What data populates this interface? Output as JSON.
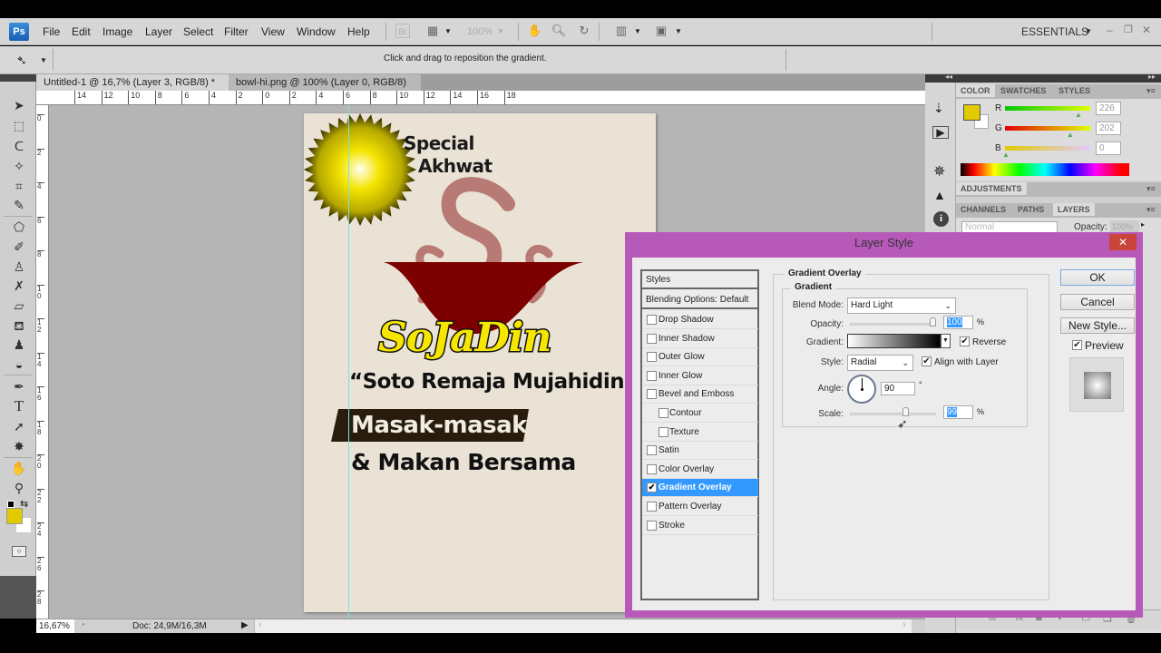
{
  "app": {
    "logo": "Ps"
  },
  "menu": [
    "File",
    "Edit",
    "Image",
    "Layer",
    "Select",
    "Filter",
    "View",
    "Window",
    "Help"
  ],
  "toolbar": {
    "zoom_level": "100%",
    "workspace": "ESSENTIALS",
    "zoom_caret": "▾"
  },
  "options_bar": {
    "hint": "Click and drag to reposition the gradient."
  },
  "doc_tabs": [
    {
      "label": "Untitled-1 @ 16,7% (Layer 3, RGB/8) *",
      "active": true
    },
    {
      "label": "bowl-hi.png @ 100% (Layer 0, RGB/8)",
      "active": false
    }
  ],
  "ruler_top": [
    "14",
    "12",
    "10",
    "8",
    "6",
    "4",
    "2",
    "0",
    "2",
    "4",
    "6",
    "8",
    "10",
    "12",
    "14",
    "16",
    "18"
  ],
  "ruler_left": [
    "0",
    "2",
    "4",
    "6",
    "8",
    "10",
    "12",
    "14",
    "16",
    "18",
    "20",
    "22",
    "24",
    "26",
    "28"
  ],
  "status": {
    "zoom": "16,67%",
    "doc": "Doc: 24,9M/16,3M"
  },
  "canvas": {
    "special": "Special",
    "akhwat": "Akhwat",
    "title": "SoJaDin",
    "subtitle": "“Soto Remaja Mujahidin”",
    "banner": "Masak-masak",
    "line2": "& Makan Bersama"
  },
  "color_panel": {
    "tabs": [
      "COLOR",
      "SWATCHES",
      "STYLES"
    ],
    "r": "226",
    "g": "202",
    "b": "0",
    "r_label": "R",
    "g_label": "G",
    "b_label": "B",
    "foreground": "#e2ca00",
    "background": "#ffffff"
  },
  "adjustments_tab": "ADJUSTMENTS",
  "layers_tabs": [
    "CHANNELS",
    "PATHS",
    "LAYERS"
  ],
  "layers": {
    "blend": "Normal",
    "opacity_label": "Opacity:",
    "opacity": "100%"
  },
  "dialog": {
    "title": "Layer Style",
    "styles_header": "Styles",
    "blending": "Blending Options: Default",
    "effects": [
      {
        "label": "Drop Shadow",
        "checked": false,
        "indent": false
      },
      {
        "label": "Inner Shadow",
        "checked": false,
        "indent": false
      },
      {
        "label": "Outer Glow",
        "checked": false,
        "indent": false
      },
      {
        "label": "Inner Glow",
        "checked": false,
        "indent": false
      },
      {
        "label": "Bevel and Emboss",
        "checked": false,
        "indent": false
      },
      {
        "label": "Contour",
        "checked": false,
        "indent": true
      },
      {
        "label": "Texture",
        "checked": false,
        "indent": true
      },
      {
        "label": "Satin",
        "checked": false,
        "indent": false
      },
      {
        "label": "Color Overlay",
        "checked": false,
        "indent": false
      },
      {
        "label": "Gradient Overlay",
        "checked": true,
        "indent": false,
        "selected": true
      },
      {
        "label": "Pattern Overlay",
        "checked": false,
        "indent": false
      },
      {
        "label": "Stroke",
        "checked": false,
        "indent": false
      }
    ],
    "section": "Gradient Overlay",
    "subsection": "Gradient",
    "blend_mode_label": "Blend Mode:",
    "blend_mode": "Hard Light",
    "opacity_label": "Opacity:",
    "opacity": "100",
    "opacity_pct": 100,
    "gradient_label": "Gradient:",
    "reverse_label": "Reverse",
    "reverse": true,
    "style_label": "Style:",
    "style": "Radial",
    "align_label": "Align with Layer",
    "align": true,
    "angle_label": "Angle:",
    "angle": "90",
    "degree": "°",
    "scale_label": "Scale:",
    "scale": "99",
    "scale_pct": 99,
    "pct": "%",
    "ok": "OK",
    "cancel": "Cancel",
    "new_style": "New Style...",
    "preview_label": "Preview",
    "preview": true,
    "close": "✕"
  },
  "checkmark": "✔"
}
